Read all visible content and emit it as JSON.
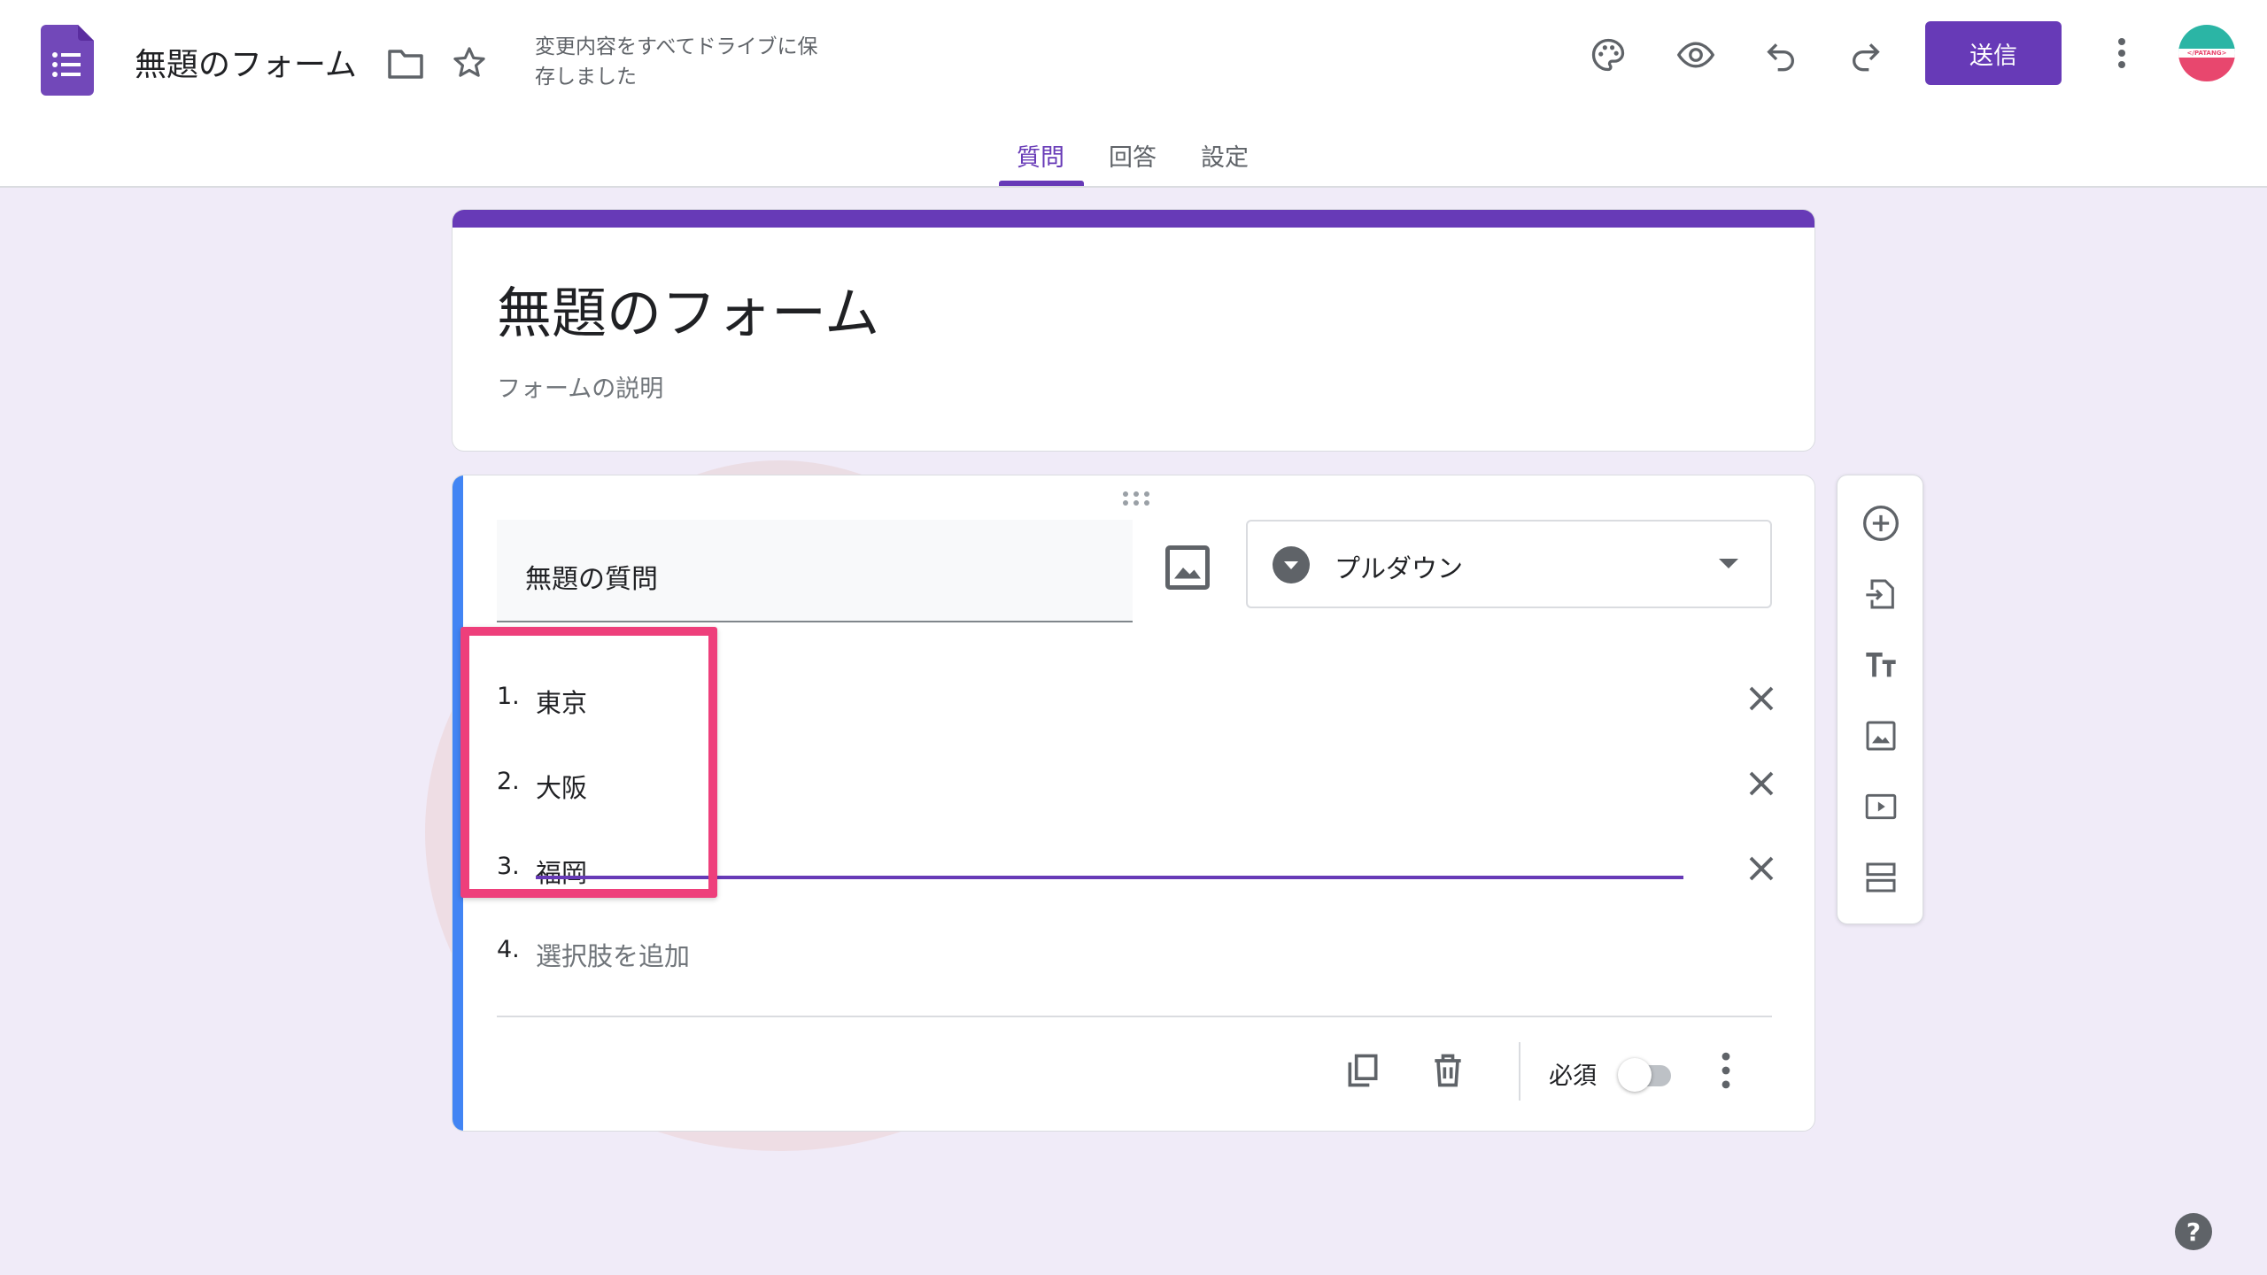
{
  "header": {
    "doc_title": "無題のフォーム",
    "save_status": "変更内容をすべてドライブに保存しました",
    "send_label": "送信",
    "avatar_text": "</PATANG>",
    "icons": [
      "forms-logo-icon",
      "folder-icon",
      "star-icon",
      "palette-icon",
      "preview-eye-icon",
      "undo-icon",
      "redo-icon",
      "more-vert-icon"
    ]
  },
  "tabs": [
    {
      "label": "質問",
      "active": true
    },
    {
      "label": "回答",
      "active": false
    },
    {
      "label": "設定",
      "active": false
    }
  ],
  "form": {
    "title": "無題のフォーム",
    "description_placeholder": "フォームの説明"
  },
  "question": {
    "title": "無題の質問",
    "type": "プルダウン",
    "options": [
      {
        "num": "1.",
        "label": "東京"
      },
      {
        "num": "2.",
        "label": "大阪"
      },
      {
        "num": "3.",
        "label": "福岡"
      }
    ],
    "add_option": {
      "num": "4.",
      "label": "選択肢を追加"
    },
    "required_label": "必須",
    "required": false
  },
  "side_toolbar": [
    "add-question-icon",
    "import-questions-icon",
    "add-title-icon",
    "add-image-icon",
    "add-video-icon",
    "add-section-icon"
  ],
  "colors": {
    "accent": "#673ab7",
    "background": "#f0ebf8",
    "question_bar": "#4285f4",
    "highlight": "#ee3f7b"
  },
  "help_label": "?"
}
